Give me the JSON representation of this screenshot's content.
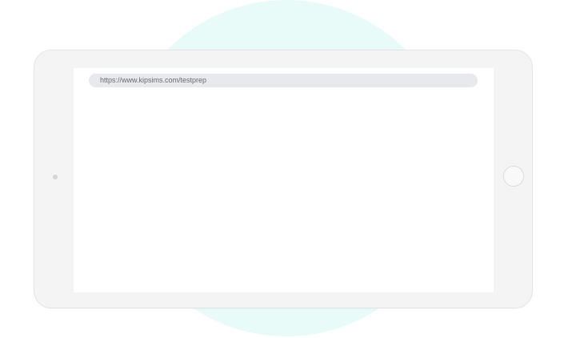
{
  "browser": {
    "url": "https://www.kipsims.com/testprep"
  },
  "colors": {
    "background_circle": "#e9fbf9",
    "device_frame": "#f4f4f4",
    "address_bar": "#e8e9ec",
    "address_text": "#666a70"
  },
  "icons": {
    "camera": "camera-icon",
    "home_button": "home-button-icon"
  }
}
